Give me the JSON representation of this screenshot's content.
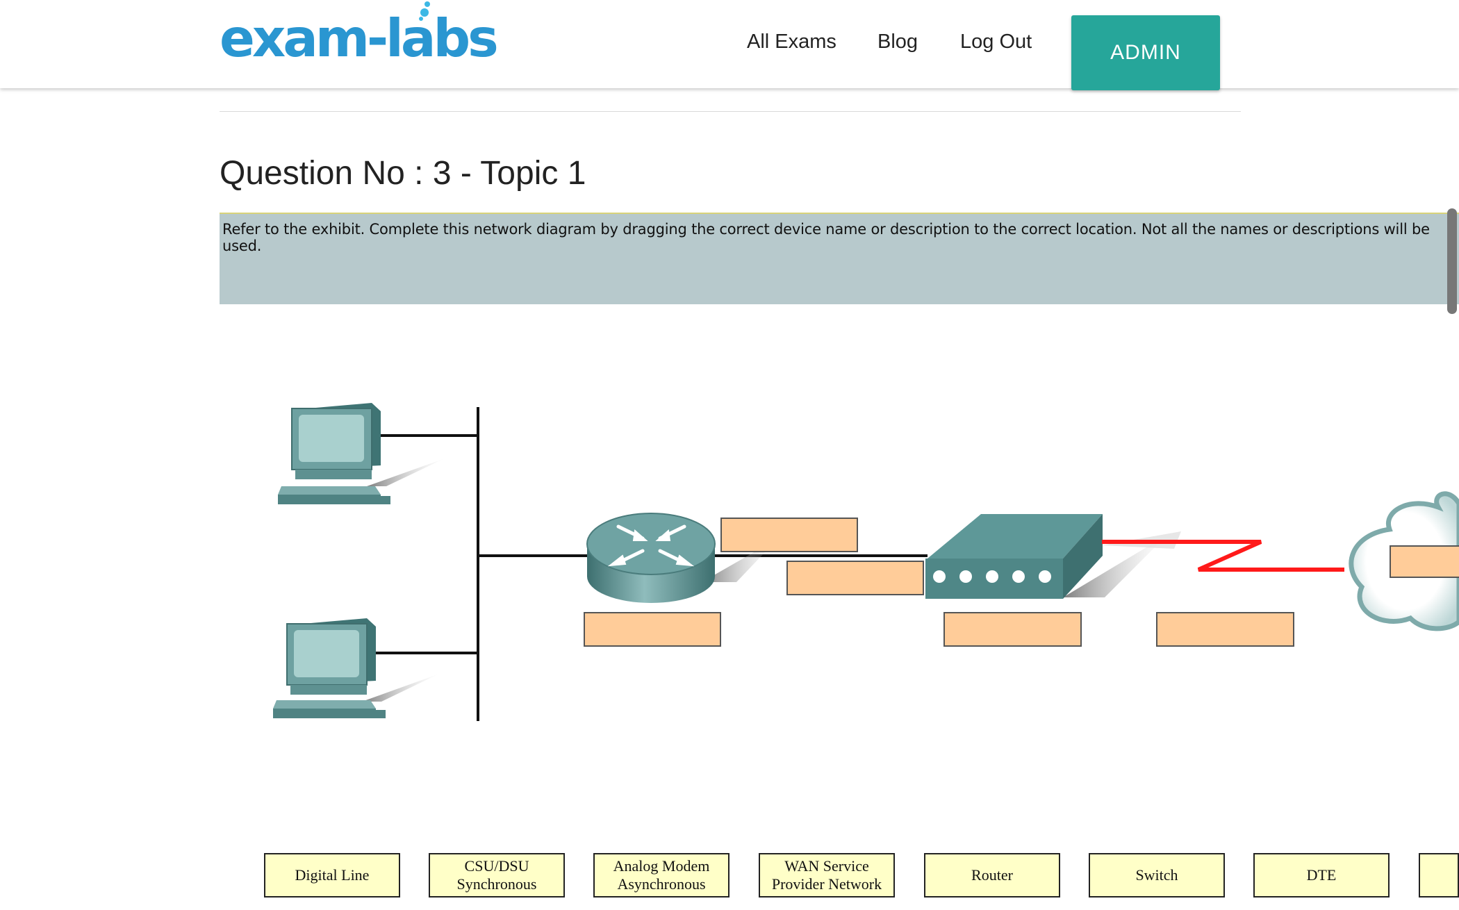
{
  "header": {
    "logo": "exam-labs",
    "nav": [
      "All Exams",
      "Blog",
      "Log Out"
    ],
    "admin_label": "ADMIN"
  },
  "question": {
    "title": "Question No : 3 - Topic 1",
    "instruction": "Refer to the exhibit.  Complete this network diagram by dragging the correct device name or description to the correct location.  Not all the names or descriptions will be used."
  },
  "colors": {
    "brand": "#2a96d1",
    "accent": "#26a69a",
    "exhibit_bg": "#b7c9cc",
    "drop_target": "#ffcc99",
    "option_tile": "#ffffc8",
    "wan_link": "#ff0000",
    "device": "#5e9898"
  },
  "options": [
    {
      "label": "Digital Line"
    },
    {
      "label": "CSU/DSU\nSynchronous"
    },
    {
      "label": "Analog Modem\nAsynchronous"
    },
    {
      "label": "WAN Service\nProvider Network"
    },
    {
      "label": "Router"
    },
    {
      "label": "Switch"
    },
    {
      "label": "DTE"
    },
    {
      "label": ""
    }
  ]
}
